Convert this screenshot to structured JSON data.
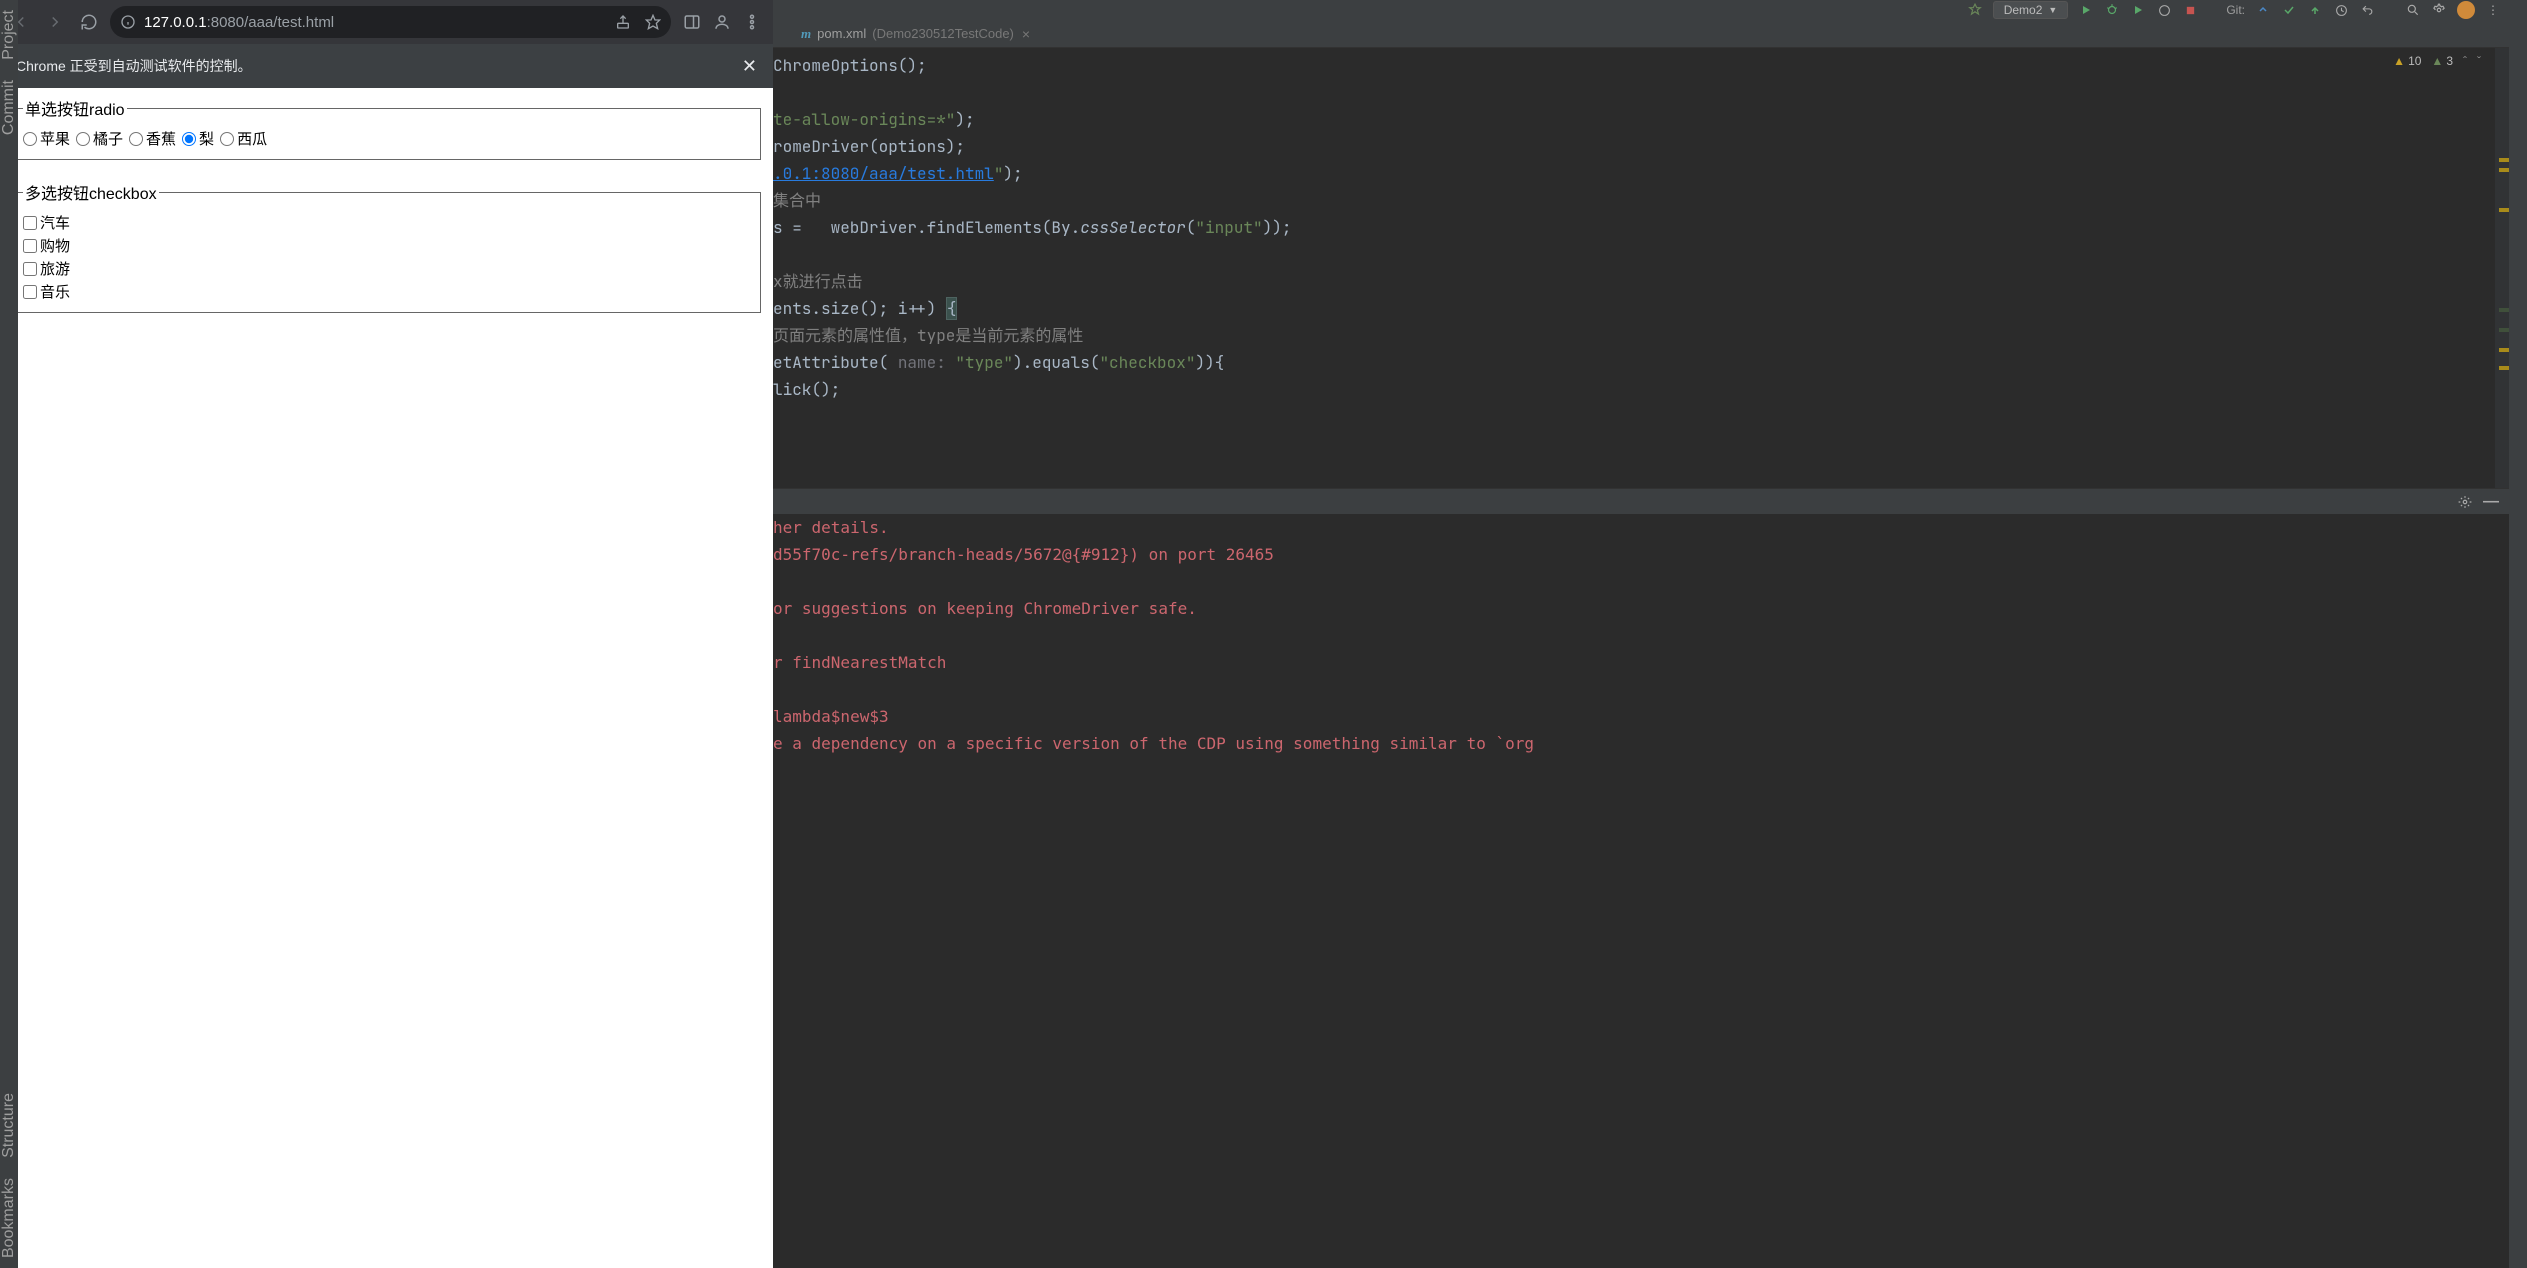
{
  "browser": {
    "url_host": "127.0.0.1",
    "url_port_path": ":8080/aaa/test.html",
    "infobar_text": "Chrome 正受到自动测试软件的控制。",
    "radio_legend": "单选按钮radio",
    "checkbox_legend": "多选按钮checkbox",
    "radios": [
      {
        "label": "苹果",
        "checked": false
      },
      {
        "label": "橘子",
        "checked": false
      },
      {
        "label": "香蕉",
        "checked": false
      },
      {
        "label": "梨",
        "checked": true
      },
      {
        "label": "西瓜",
        "checked": false
      }
    ],
    "checkboxes": [
      {
        "label": "汽车",
        "checked": false
      },
      {
        "label": "购物",
        "checked": false
      },
      {
        "label": "旅游",
        "checked": false
      },
      {
        "label": "音乐",
        "checked": false
      }
    ]
  },
  "ide": {
    "sidebar_left_labels": [
      "Project",
      "Commit",
      "Structure",
      "Bookmarks"
    ],
    "run_config_name": "Demo2",
    "git_label": "Git:",
    "tab_file": "pom.xml",
    "tab_qualifier": "(Demo230512TestCode)",
    "warnings": {
      "yellow": "10",
      "grey": "3"
    },
    "code_lines": [
      {
        "segs": [
          {
            "t": "ChromeOptions();",
            "c": ""
          }
        ]
      },
      {
        "segs": []
      },
      {
        "segs": [
          {
            "t": "te-allow-origins=*\"",
            "c": "c-str"
          },
          {
            "t": ");",
            "c": ""
          }
        ]
      },
      {
        "segs": [
          {
            "t": "romeDriver(options);",
            "c": ""
          }
        ]
      },
      {
        "segs": [
          {
            "t": ".0.1:8080/aaa/test.html",
            "c": "c-link"
          },
          {
            "t": "\"",
            "c": "c-str"
          },
          {
            "t": ");",
            "c": ""
          }
        ]
      },
      {
        "segs": [
          {
            "t": "集合中",
            "c": "c-com"
          }
        ]
      },
      {
        "segs": [
          {
            "t": "s =   webDriver.findElements(By.",
            "c": ""
          },
          {
            "t": "cssSelector",
            "c": "c-static"
          },
          {
            "t": "(",
            "c": ""
          },
          {
            "t": "\"input\"",
            "c": "c-str"
          },
          {
            "t": "));",
            "c": ""
          }
        ]
      },
      {
        "segs": []
      },
      {
        "segs": [
          {
            "t": "x就进行点击",
            "c": "c-com"
          }
        ]
      },
      {
        "segs": [
          {
            "t": "ents.size(); i++) ",
            "c": ""
          },
          {
            "t": "{",
            "c": "c-brace-hl"
          }
        ]
      },
      {
        "segs": [
          {
            "t": "页面元素的属性值，type是当前元素的属性",
            "c": "c-com"
          }
        ]
      },
      {
        "segs": [
          {
            "t": "etAttribute( ",
            "c": ""
          },
          {
            "t": "name: ",
            "c": "c-param"
          },
          {
            "t": "\"type\"",
            "c": "c-str"
          },
          {
            "t": ").equals(",
            "c": ""
          },
          {
            "t": "\"checkbox\"",
            "c": "c-str"
          },
          {
            "t": ")){",
            "c": ""
          }
        ]
      },
      {
        "segs": [
          {
            "t": "lick();",
            "c": ""
          }
        ]
      }
    ],
    "console_lines": [
      {
        "t": "her details.",
        "c": "err"
      },
      {
        "t": "d55f70c-refs/branch-heads/5672@{#912}) on port 26465",
        "c": "err"
      },
      {
        "t": "",
        "c": ""
      },
      {
        "t": "or suggestions on keeping ChromeDriver safe.",
        "c": "err"
      },
      {
        "t": "",
        "c": ""
      },
      {
        "t": "r findNearestMatch",
        "c": "err"
      },
      {
        "t": "",
        "c": ""
      },
      {
        "t": "lambda$new$3",
        "c": "err"
      },
      {
        "t": "e a dependency on a specific version of the CDP using something similar to `org",
        "c": "err"
      }
    ]
  }
}
